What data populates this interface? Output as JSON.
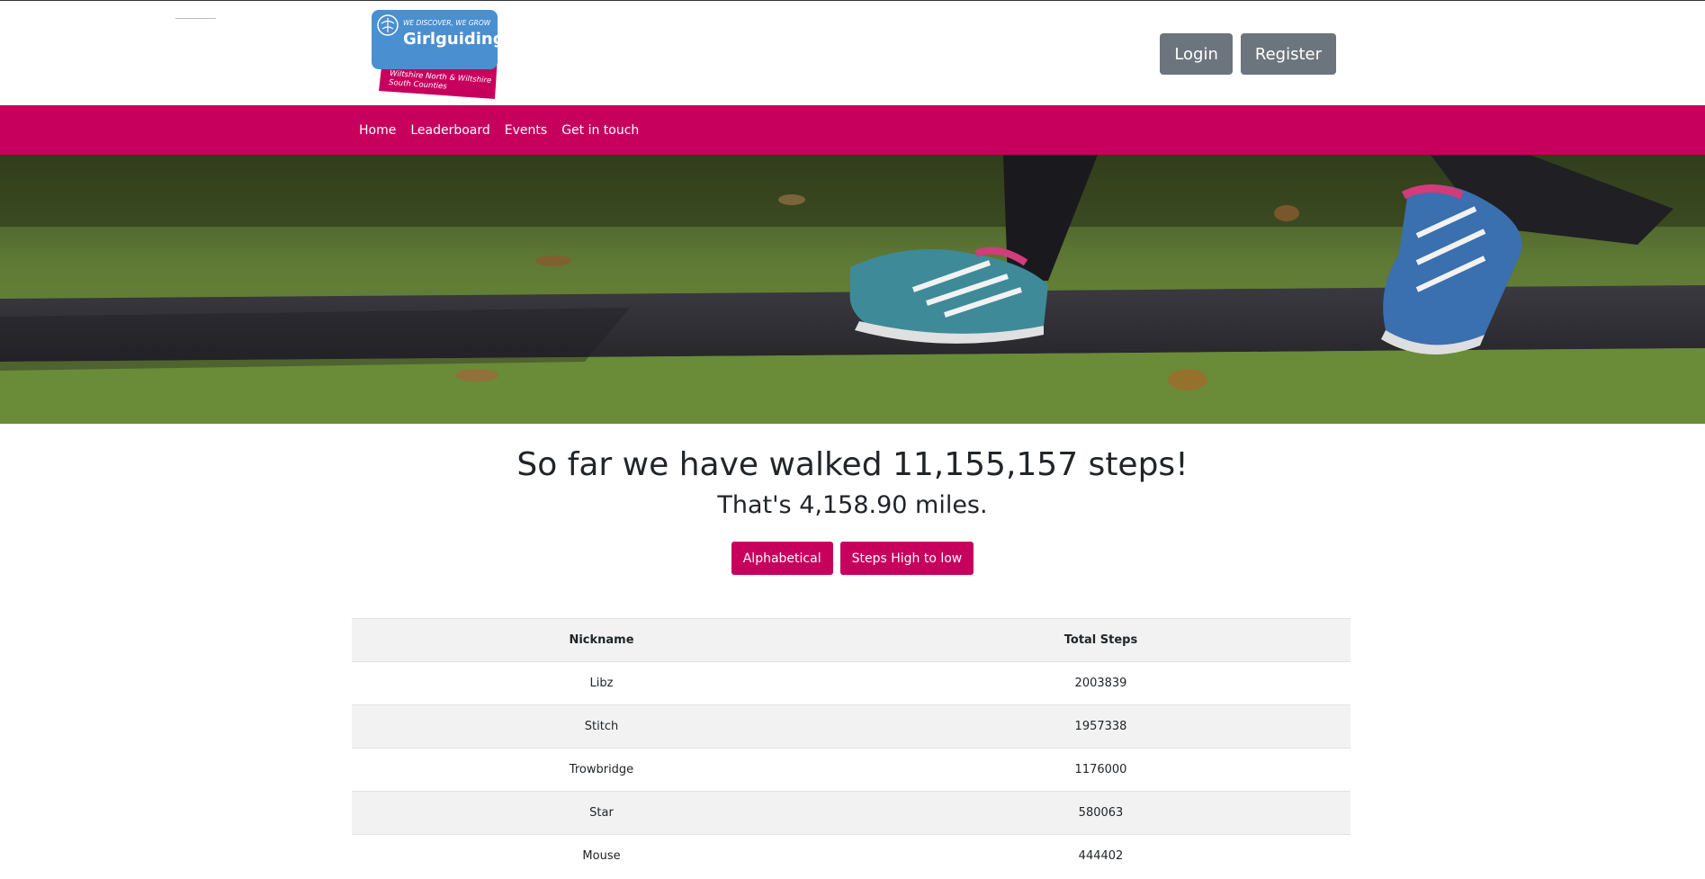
{
  "logo": {
    "tagline": "WE DISCOVER, WE GROW",
    "brand": "Girlguiding",
    "region_line1": "Wiltshire North & Wiltshire",
    "region_line2": "South Counties"
  },
  "auth": {
    "login_label": "Login",
    "register_label": "Register"
  },
  "nav": {
    "items": [
      "Home",
      "Leaderboard",
      "Events",
      "Get in touch"
    ]
  },
  "hero": {
    "image": "walking-trainers-on-grass"
  },
  "summary": {
    "steps_heading": "So far we have walked 11,155,157 steps!",
    "miles_heading": "That's 4,158.90 miles."
  },
  "sort": {
    "alphabetical_label": "Alphabetical",
    "steps_label": "Steps High to low"
  },
  "leaderboard": {
    "headers": [
      "Nickname",
      "Total Steps"
    ],
    "rows": [
      [
        "Libz",
        "2003839"
      ],
      [
        "Stitch",
        "1957338"
      ],
      [
        "Trowbridge",
        "1176000"
      ],
      [
        "Star",
        "580063"
      ],
      [
        "Mouse",
        "444402"
      ]
    ]
  },
  "colors": {
    "brand_pink": "#c7005e",
    "brand_blue": "#4a8fd0",
    "button_gray": "#6c757d"
  }
}
